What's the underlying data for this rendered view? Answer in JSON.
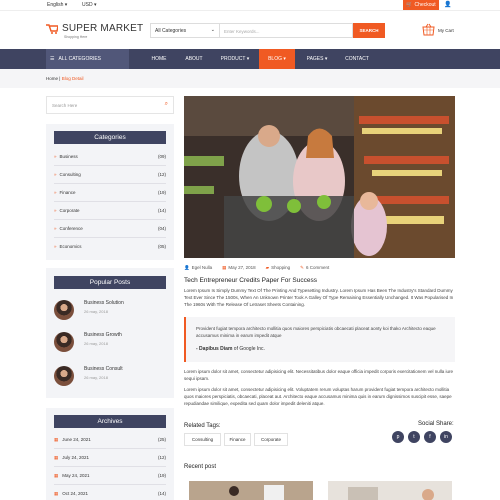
{
  "topbar": {
    "language": "English",
    "currency": "USD",
    "checkout": "Checkout"
  },
  "header": {
    "logo_title": "SUPER MARKET",
    "logo_subtitle": "Shopping Here",
    "category_select": "All Categories",
    "search_placeholder": "Enter Keywords...",
    "search_button": "SEARCH",
    "cart_label": "My Cart"
  },
  "nav": {
    "all_categories": "ALL CATEGORIES",
    "items": [
      "HOME",
      "ABOUT",
      "PRODUCT",
      "BLOG",
      "PAGES",
      "CONTACT"
    ]
  },
  "breadcrumb": {
    "home": "Home",
    "current": "Blog Detail"
  },
  "sidebar": {
    "search_placeholder": "Search Here",
    "categories_title": "Categories",
    "categories": [
      {
        "label": "Business",
        "count": "(09)"
      },
      {
        "label": "Consulting",
        "count": "(12)"
      },
      {
        "label": "Finance",
        "count": "(19)"
      },
      {
        "label": "Corporate",
        "count": "(14)"
      },
      {
        "label": "Conference",
        "count": "(04)"
      },
      {
        "label": "Economics",
        "count": "(05)"
      }
    ],
    "popular_title": "Popular Posts",
    "popular": [
      {
        "title": "Business Solution",
        "date": "26 may, 2018"
      },
      {
        "title": "Business Growth",
        "date": "26 may, 2018"
      },
      {
        "title": "Business Consult",
        "date": "26 may, 2018"
      }
    ],
    "archives_title": "Archives",
    "archives": [
      {
        "date": "June 24, 2021",
        "count": "(25)"
      },
      {
        "date": "July 24, 2021",
        "count": "(12)"
      },
      {
        "date": "May 24, 2021",
        "count": "(19)"
      },
      {
        "date": "Oct 24, 2021",
        "count": "(14)"
      }
    ]
  },
  "post": {
    "author": "Egel Nulla",
    "date": "May 27, 2018",
    "category": "Shopping",
    "comments": "6 Comment",
    "title": "Tech Entrepreneur Credits Paper For Success",
    "intro": "Lorem Ipsum Is Simply Dummy Text Of The Printing And Typesetting Industry. Lorem Ipsum Has Been The Industry's Standard Dummy Text Ever Since The 1500s, When An Unknown Printer Took A Galley Of Type Remaining Essentially Unchanged. It Was Popularised In The 1960s With The Release Of Letraset Sheets Containing.",
    "quote": "Provident fugiat tempora architecto mollitia quos maiores perspiciatis obcaecati placeat aonty koi thako Architecto eaque accusamus minima in earum impedit atque",
    "quote_author": "- Dapibus Diam",
    "quote_source": " of Google Inc.",
    "para2": "Lorem ipsum dolor sit amet, consectetur adipisicing elit. Necessitatibus dolor eaque officia impedit corporis exercitationem vel nulla iure sequi ipsam.",
    "para3": "Lorem ipsum dolor sit amet, consectetur adipisicing elit. Voluptatem rerum voluptas harum provident fugiat tempora architecto mollitia quos maiores perspiciatis, obcaecati, placeat aut. Architecto eaque accusamus minima quis in earum dignissimos suscipit esse, saepe repudiandae similique, expedita sed quam dolor impedit deleniti atque.",
    "related_tags_label": "Related Tags:",
    "tags": [
      "Consulting",
      "Finance",
      "Corporate"
    ],
    "share_label": "Social Share:",
    "share_icons": [
      "pinterest-icon",
      "twitter-icon",
      "facebook-icon",
      "linkedin-icon"
    ],
    "recent_label": "Recent post"
  },
  "colors": {
    "accent": "#f05a23",
    "navy": "#3f4461"
  }
}
